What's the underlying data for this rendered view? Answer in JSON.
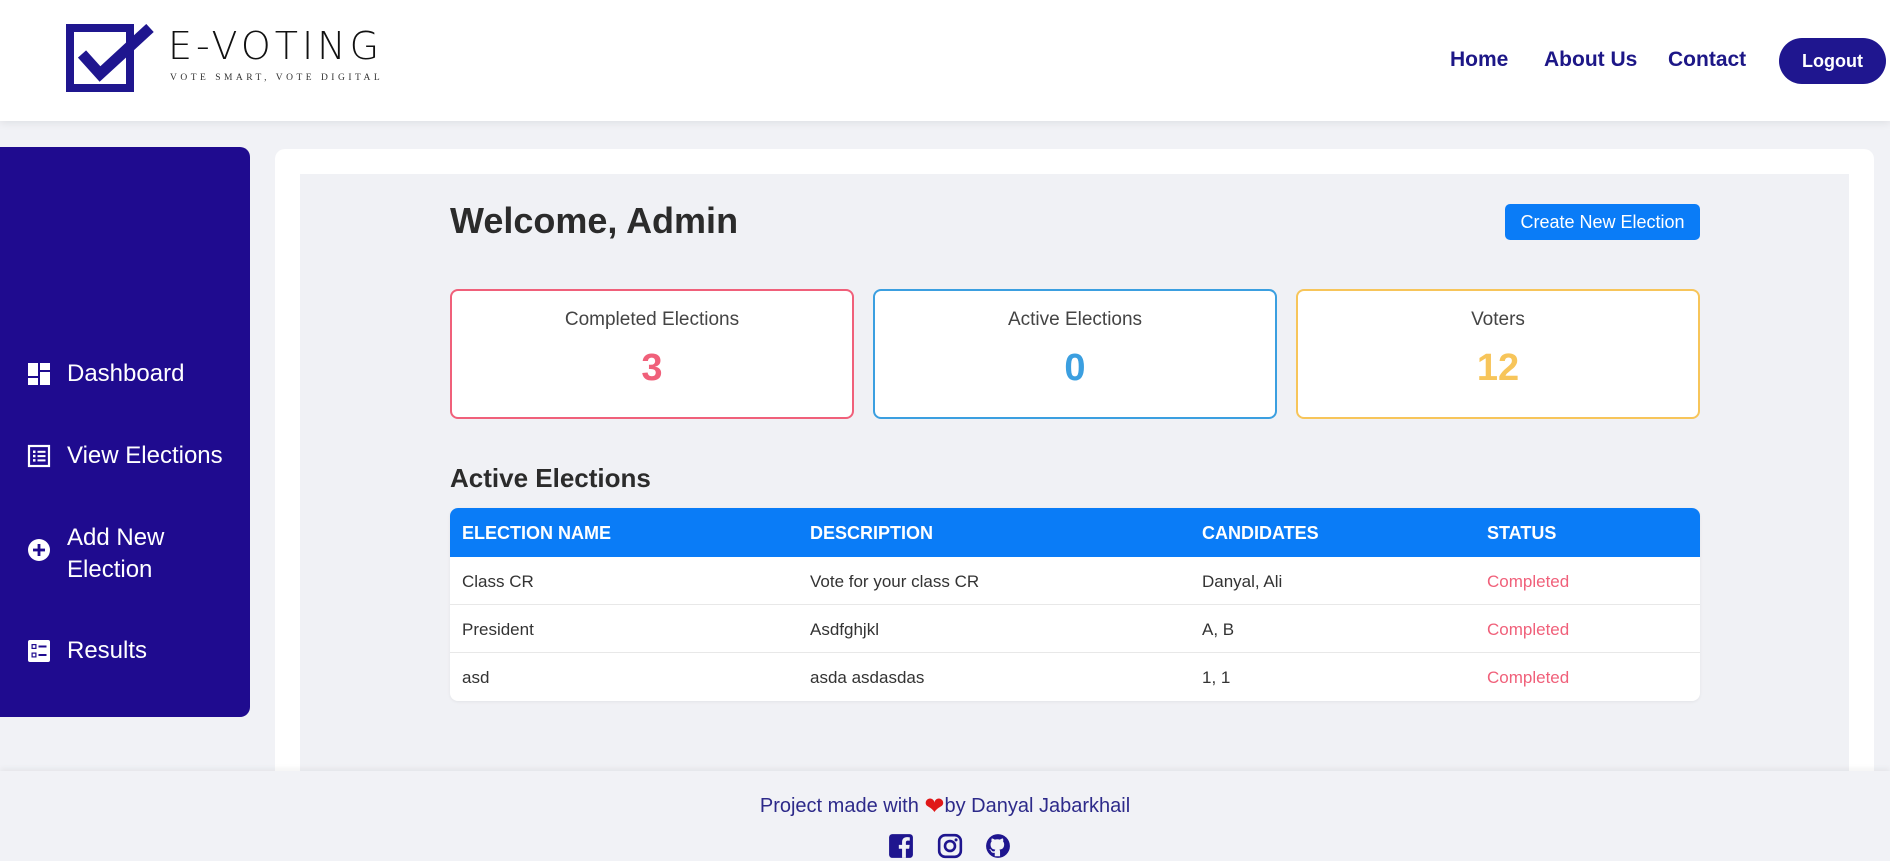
{
  "brand": {
    "name": "E-VOTING",
    "tagline": "VOTE SMART, VOTE DIGITAL"
  },
  "nav": {
    "home": "Home",
    "about": "About Us",
    "contact": "Contact",
    "logout": "Logout"
  },
  "sidebar": {
    "items": [
      {
        "label": "Dashboard",
        "icon": "dashboard-icon"
      },
      {
        "label": "View Elections",
        "icon": "list-icon"
      },
      {
        "label": "Add New\nElection",
        "icon": "plus-circle-icon"
      },
      {
        "label": "Results",
        "icon": "results-icon"
      }
    ]
  },
  "main": {
    "welcome": "Welcome, Admin",
    "create_button": "Create New Election",
    "stats": [
      {
        "label": "Completed Elections",
        "value": "3",
        "color": "#f0607a"
      },
      {
        "label": "Active Elections",
        "value": "0",
        "color": "#3b9fe0"
      },
      {
        "label": "Voters",
        "value": "12",
        "color": "#f7c55a"
      }
    ],
    "section_title": "Active Elections",
    "table": {
      "headers": [
        "ELECTION NAME",
        "DESCRIPTION",
        "CANDIDATES",
        "STATUS"
      ],
      "rows": [
        [
          "Class CR",
          "Vote for your class CR",
          "Danyal, Ali",
          "Completed"
        ],
        [
          "President",
          "Asdfghjkl",
          "A, B",
          "Completed"
        ],
        [
          "asd",
          "asda asdasdas",
          "1, 1",
          "Completed"
        ]
      ]
    }
  },
  "footer": {
    "text_before": "Project made with ",
    "text_after": "by Danyal Jabarkhail",
    "heart_icon": "heart-icon",
    "social": [
      "facebook-icon",
      "instagram-icon",
      "github-icon"
    ]
  },
  "colors": {
    "primary": "#1f0b8f",
    "accent": "#0a7cf7",
    "completed": "#f0607a",
    "active": "#3b9fe0",
    "voters": "#f7c55a"
  }
}
